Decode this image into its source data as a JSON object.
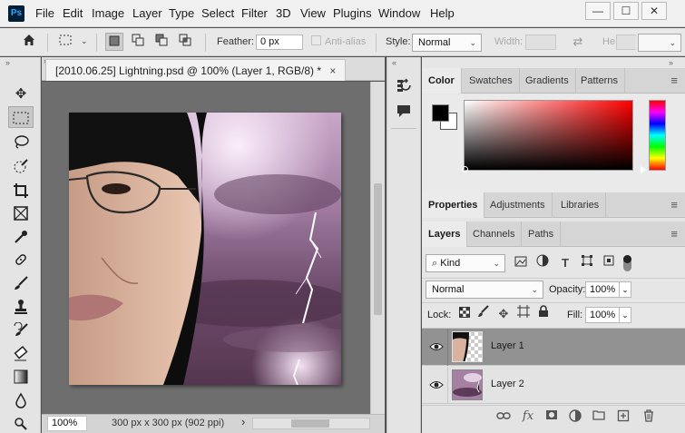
{
  "app": {
    "logo": "Ps"
  },
  "menu": [
    "File",
    "Edit",
    "Image",
    "Layer",
    "Type",
    "Select",
    "Filter",
    "3D",
    "View",
    "Plugins",
    "Window",
    "Help"
  ],
  "window_buttons": {
    "minimize": "—",
    "restore": "☐",
    "close": "✕"
  },
  "options": {
    "feather_label": "Feather:",
    "feather_value": "0 px",
    "antialias_label": "Anti-alias",
    "style_label": "Style:",
    "style_value": "Normal",
    "width_label": "Width:",
    "height_label": "He"
  },
  "document": {
    "tab_title": "[2010.06.25] Lightning.psd @ 100% (Layer 1, RGB/8) *",
    "close": "×",
    "zoom": "100%",
    "doc_info": "300 px x 300 px (902 ppi)",
    "info_arrow": "›"
  },
  "panels": {
    "color_tabs": [
      "Color",
      "Swatches",
      "Gradients",
      "Patterns"
    ],
    "properties_tabs": [
      "Properties",
      "Adjustments",
      "Libraries"
    ],
    "layers_tabs": [
      "Layers",
      "Channels",
      "Paths"
    ],
    "menu_icon": "≡"
  },
  "layers_panel": {
    "filter_kind": "Kind",
    "blend_mode": "Normal",
    "opacity_label": "Opacity:",
    "opacity_value": "100%",
    "lock_label": "Lock:",
    "fill_label": "Fill:",
    "fill_value": "100%",
    "layers": [
      {
        "name": "Layer 1",
        "selected": true,
        "visible": true
      },
      {
        "name": "Layer 2",
        "selected": false,
        "visible": true
      }
    ]
  },
  "colors": {
    "foreground": "#000000",
    "background": "#ffffff",
    "picker_hue": "#ff0000",
    "selected_layer": "#929292"
  }
}
